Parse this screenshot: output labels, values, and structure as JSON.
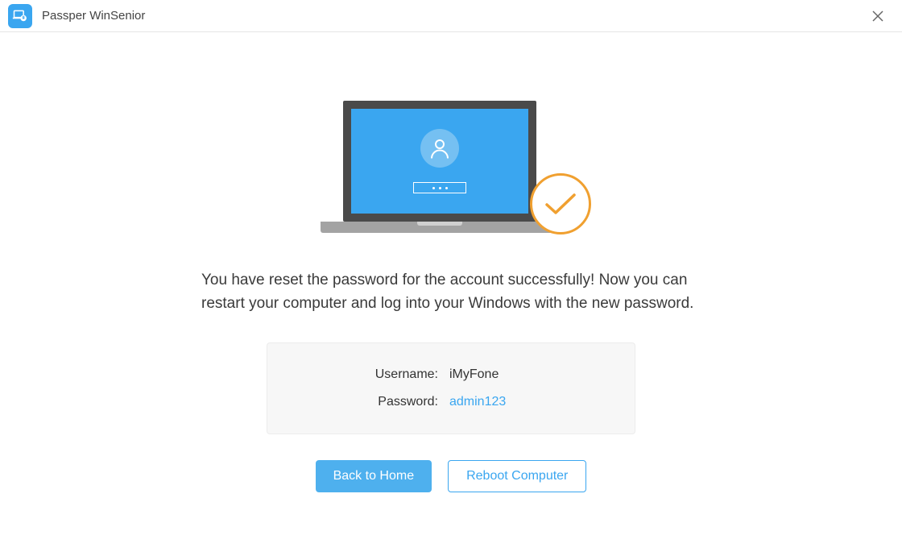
{
  "titlebar": {
    "app_name": "Passper WinSenior"
  },
  "main": {
    "message": "You have reset the password for the account successfully! Now you can restart your computer and log into your Windows with the new password."
  },
  "credentials": {
    "username_label": "Username:",
    "username_value": "iMyFone",
    "password_label": "Password:",
    "password_value": "admin123"
  },
  "buttons": {
    "back_label": "Back to Home",
    "reboot_label": "Reboot Computer"
  },
  "colors": {
    "accent": "#3aa6f0",
    "success_badge": "#f0a030"
  }
}
